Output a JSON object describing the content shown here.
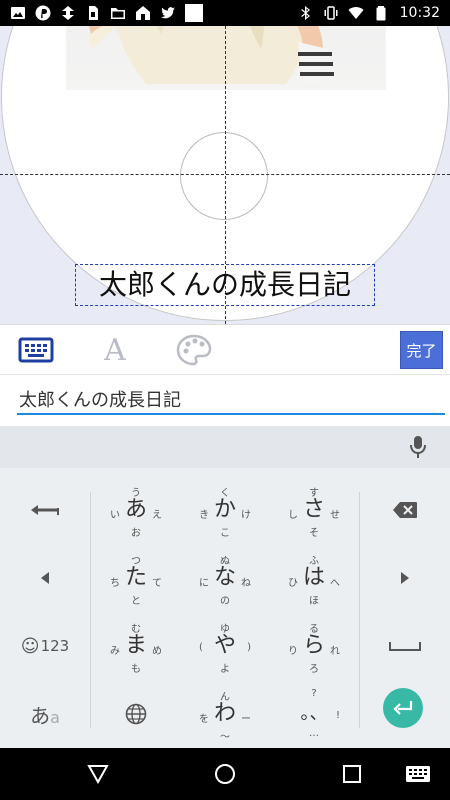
{
  "status_bar": {
    "time": "10:32",
    "left_icons": [
      "image-icon",
      "pinterest-icon",
      "transfer-icon",
      "sim-icon",
      "folder-icon",
      "home-icon",
      "twitter-icon",
      "blank-icon"
    ],
    "right_icons": [
      "bluetooth-icon",
      "vibrate-icon",
      "wifi-icon",
      "battery-icon"
    ]
  },
  "canvas": {
    "title_text": "太郎くんの成長日記"
  },
  "toolbar": {
    "done_label": "完了",
    "font_tool_glyph": "A",
    "accent_color": "#4c6fd7"
  },
  "input": {
    "value": "太郎くんの成長日記",
    "underline_color": "#1e88e5"
  },
  "keyboard": {
    "keys": [
      {
        "main": "あ",
        "top": "う",
        "left": "い",
        "right": "え",
        "bottom": "お"
      },
      {
        "main": "か",
        "top": "く",
        "left": "き",
        "right": "け",
        "bottom": "こ"
      },
      {
        "main": "さ",
        "top": "す",
        "left": "し",
        "right": "せ",
        "bottom": "そ"
      },
      {
        "main": "た",
        "top": "つ",
        "left": "ち",
        "right": "て",
        "bottom": "と"
      },
      {
        "main": "な",
        "top": "ぬ",
        "left": "に",
        "right": "ね",
        "bottom": "の"
      },
      {
        "main": "は",
        "top": "ふ",
        "left": "ひ",
        "right": "へ",
        "bottom": "ほ"
      },
      {
        "main": "ま",
        "top": "む",
        "left": "み",
        "right": "め",
        "bottom": "も"
      },
      {
        "main": "や",
        "top": "ゆ",
        "left": "(",
        "right": ")",
        "bottom": "よ"
      },
      {
        "main": "ら",
        "top": "る",
        "left": "り",
        "right": "れ",
        "bottom": "ろ"
      },
      {
        "main": "わ",
        "top": "ん",
        "left": "を",
        "right": "ー",
        "bottom": "〜"
      },
      {
        "main": "。",
        "top": "?",
        "left": "",
        "right": "!",
        "bottom": "…"
      }
    ],
    "punct_main_2": "、",
    "num_label": "123",
    "mode_label_1": "あ",
    "mode_label_2": "a",
    "enter_color": "#37b9a6"
  }
}
